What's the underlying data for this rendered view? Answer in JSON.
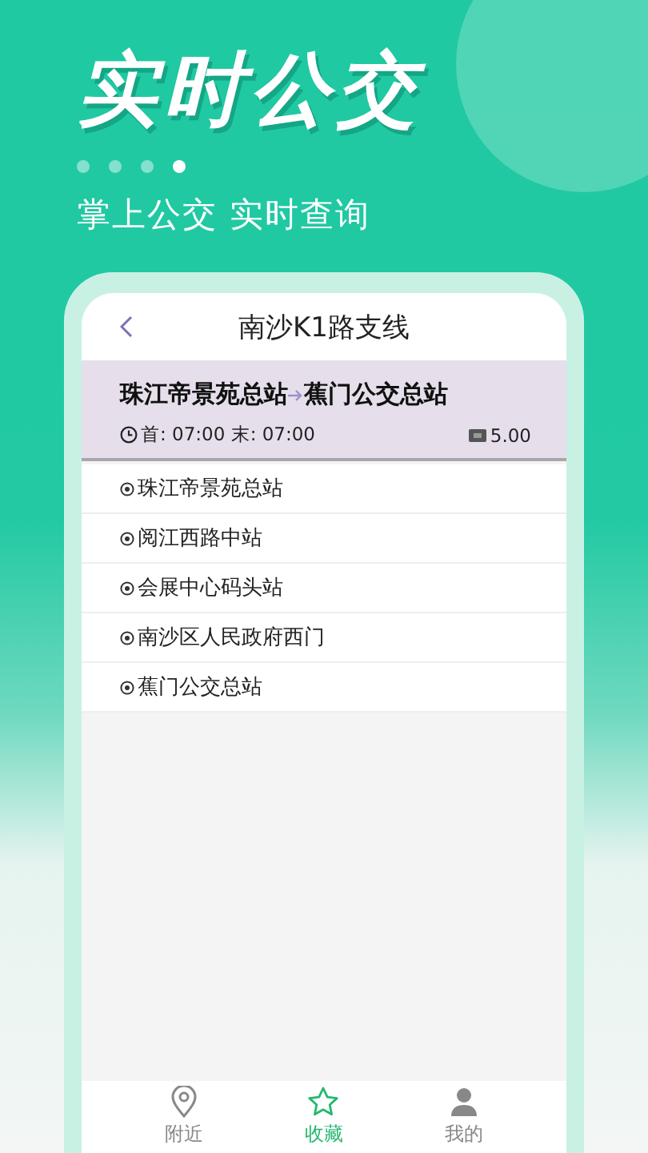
{
  "banner": {
    "title": "实时公交",
    "dots": [
      {
        "selected": false
      },
      {
        "selected": false
      },
      {
        "selected": false
      },
      {
        "selected": true
      }
    ],
    "subtitle": "掌上公交 实时查询"
  },
  "header": {
    "title": "南沙K1路支线"
  },
  "route": {
    "from": "珠江帝景苑总站",
    "to": "蕉门公交总站",
    "times": "首: 07:00 末: 07:00",
    "fare": "5.00"
  },
  "stops": [
    {
      "name": "珠江帝景苑总站"
    },
    {
      "name": "阅江西路中站"
    },
    {
      "name": "会展中心码头站"
    },
    {
      "name": "南沙区人民政府西门"
    },
    {
      "name": "蕉门公交总站"
    }
  ],
  "tabs": [
    {
      "label": "附近",
      "kind": "pin",
      "selected": false
    },
    {
      "label": "收藏",
      "kind": "star",
      "selected": true
    },
    {
      "label": "我的",
      "kind": "person",
      "selected": false
    }
  ]
}
